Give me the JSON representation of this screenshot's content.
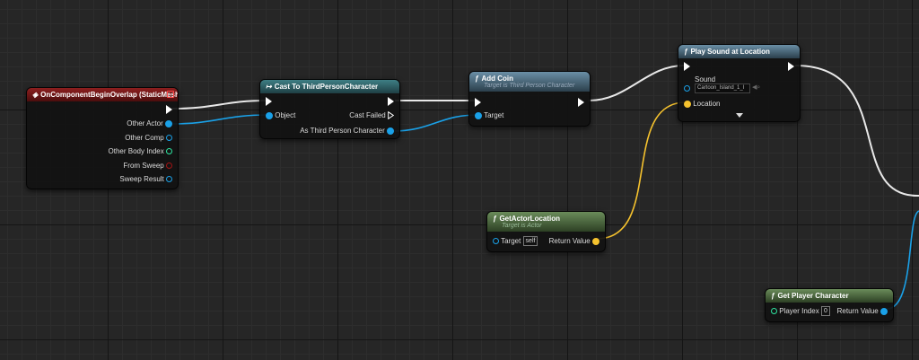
{
  "colors": {
    "exec": "#ffffff",
    "object": "#1aa1e8",
    "vector": "#f5c22e",
    "event_header": "#8e1f1f",
    "func_header": "#3b5566",
    "pure_header": "#3f5d33"
  },
  "nodes": {
    "overlap": {
      "title": "OnComponentBeginOverlap (StaticMesh)",
      "pins": [
        "Other Actor",
        "Other Comp",
        "Other Body Index",
        "From Sweep",
        "Sweep Result"
      ]
    },
    "cast": {
      "title": "Cast To ThirdPersonCharacter",
      "in_object": "Object",
      "cast_failed": "Cast Failed",
      "as_char": "As Third Person Character"
    },
    "addcoin": {
      "title": "Add Coin",
      "subtitle": "Target is Third Person Character",
      "target": "Target"
    },
    "playsound": {
      "title": "Play Sound at Location",
      "sound": "Sound",
      "sound_value": "Cartoon_Island_1_I",
      "location": "Location"
    },
    "getloc": {
      "title": "GetActorLocation",
      "subtitle": "Target is Actor",
      "target": "Target",
      "target_default": "self",
      "return": "Return Value"
    },
    "getplayer": {
      "title": "Get Player Character",
      "player_index": "Player Index",
      "player_index_value": "0",
      "return": "Return Value"
    }
  }
}
